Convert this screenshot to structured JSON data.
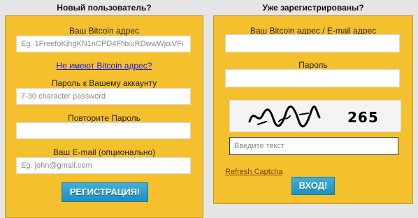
{
  "register": {
    "title": "Новый пользователь?",
    "bitcoin_label": "Ваш Bitcoin адрес",
    "bitcoin_placeholder": "Eg. 1FreefoKihgKN1nCPD4FNxuRDwwWjoiVFi",
    "no_bitcoin_link": "Не имеют Bitcoin адрес?",
    "password_label": "Пароль к Вашему аккаунту",
    "password_placeholder": "7-30 character password",
    "repeat_label": "Повторите Пароль",
    "repeat_placeholder": "",
    "email_label": "Ваш E-mail (опционально)",
    "email_placeholder": "Eg. john@gmail.com",
    "submit_label": "РЕГИСТРАЦИЯ!"
  },
  "login": {
    "title": "Уже зарегистрированы?",
    "account_label": "Ваш Bitcoin адрес / E-mail адрес",
    "account_placeholder": "",
    "password_label": "Пароль",
    "password_placeholder": "",
    "captcha_code": "265",
    "captcha_input_placeholder": "Введите текст",
    "refresh_captcha": "Refresh Captcha",
    "submit_label": "ВХОД!"
  },
  "colors": {
    "card_background": "#f5c02e",
    "button_background": "#2a9fd0",
    "page_background": "#e6e6e6"
  }
}
